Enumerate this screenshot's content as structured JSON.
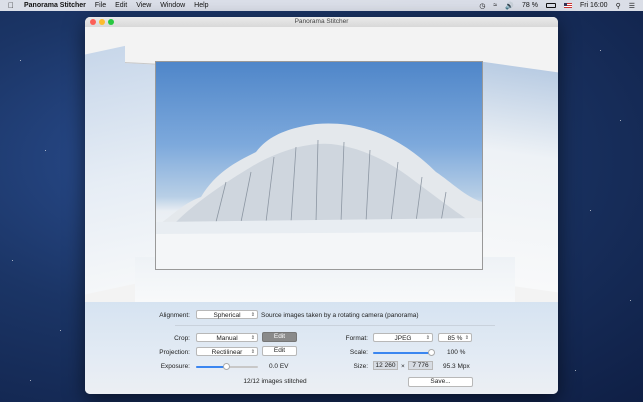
{
  "menubar": {
    "apple_icon": "apple-logo-icon",
    "app_name": "Panorama Stitcher",
    "menus": [
      "File",
      "Edit",
      "View",
      "Window",
      "Help"
    ],
    "battery": "78 %",
    "flag_icon": "us-flag-icon",
    "clock": "Fri 16:00"
  },
  "window": {
    "title": "Panorama Stitcher"
  },
  "panel": {
    "alignment_label": "Alignment:",
    "alignment_value": "Spherical",
    "alignment_description": "Source images taken by a rotating camera (panorama)",
    "crop_label": "Crop:",
    "crop_value": "Manual",
    "crop_edit": "Edit",
    "projection_label": "Projection:",
    "projection_value": "Rectilinear",
    "projection_edit": "Edit",
    "exposure_label": "Exposure:",
    "exposure_value": "0.0 EV",
    "exposure_level": 0.5,
    "format_label": "Format:",
    "format_value": "JPEG",
    "quality_value": "85 %",
    "scale_label": "Scale:",
    "scale_value": "100 %",
    "scale_level": 1.0,
    "size_label": "Size:",
    "size_width": "12 260",
    "size_times": "×",
    "size_height": "7 776",
    "megapixels": "95.3 Mpx",
    "status": "12/12 images stitched",
    "save_label": "Save..."
  },
  "colors": {
    "accent": "#3b86f0",
    "close": "#fc5f57",
    "minimize": "#fdbc2e",
    "zoom": "#28c840"
  }
}
